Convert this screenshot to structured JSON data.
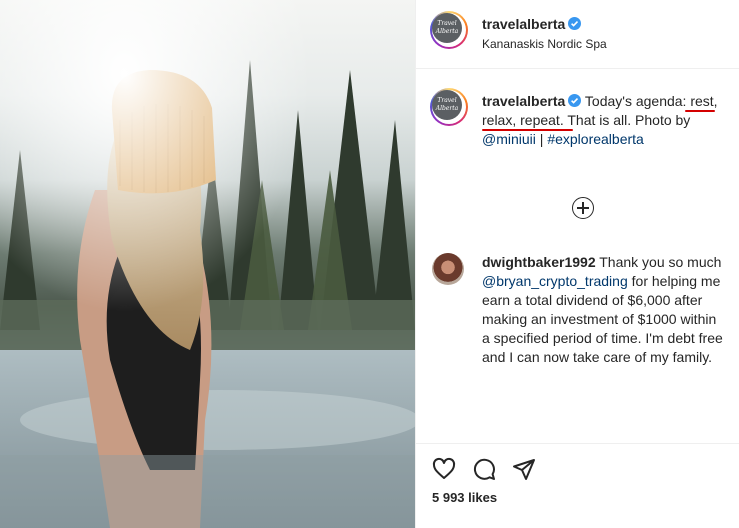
{
  "post": {
    "account": "travelalberta",
    "location": "Kananaskis Nordic Spa",
    "avatar_text": [
      "Travel",
      "Alberta",
      "CANADA"
    ],
    "caption": {
      "user": "travelalberta",
      "text_before": "Today's agenda: ",
      "highlight": "rest, relax, repeat.",
      "text_after": " That is all. Photo by ",
      "mention": "@miniuii",
      "separator": " | ",
      "hashtag": "#explorealberta"
    },
    "likes": "5 993 likes"
  },
  "comment": {
    "user": "dwightbaker1992",
    "text_before": " Thank you so much ",
    "mention": "@bryan_crypto_trading",
    "text_after": " for helping me earn a total dividend of $6,000 after making an investment of $1000 within a specified period of time. I'm debt free and I can now take care of my family."
  },
  "icons": {
    "verified": "verified-badge-icon",
    "load_more": "plus-circle-icon",
    "like": "heart-icon",
    "comment": "comment-bubble-icon",
    "share": "paper-plane-icon"
  },
  "colors": {
    "verified": "#3897f0",
    "link": "#00376b",
    "annotation_underline": "#d40000"
  }
}
